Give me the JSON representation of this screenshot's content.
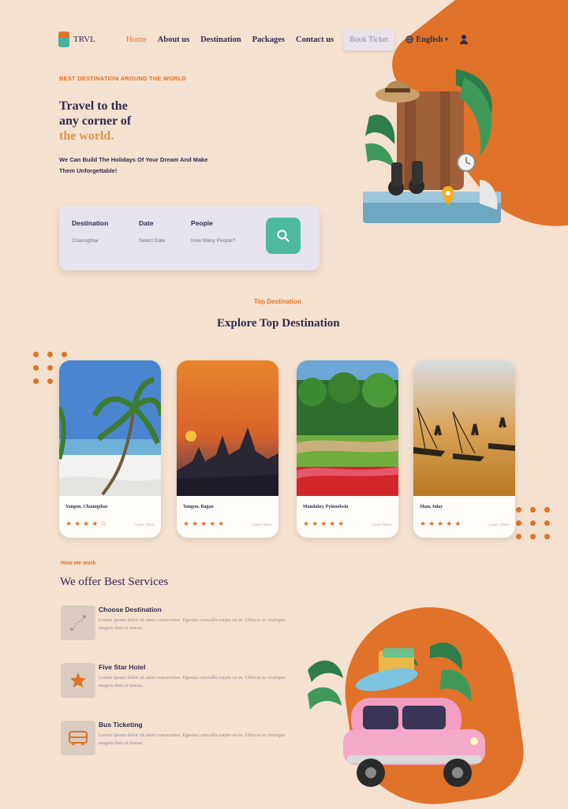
{
  "nav": {
    "logo": "TRVL",
    "links": [
      "Home",
      "About us",
      "Destination",
      "Packages",
      "Contact us"
    ],
    "book_ticket": "Book Ticket",
    "language": "English",
    "language_icon": "globe-icon",
    "user_icon": "user-icon"
  },
  "hero": {
    "eyebrow": "BEST DESTINATION AROUND THE WORLD",
    "title_line1": "Travel to the",
    "title_line2": "any corner of",
    "title_accent": "the world.",
    "subtitle": "We Can Build The Holidays Of Your Dream And Make Them Unforgettable!"
  },
  "search": {
    "destination_label": "Destination",
    "destination_placeholder": "Chaungthar",
    "date_label": "Date",
    "date_placeholder": "Select Date",
    "people_label": "People",
    "people_placeholder": "How Many People?",
    "button_icon": "search-icon"
  },
  "top_destination": {
    "eyebrow": "Top Destination",
    "title": "Explore Top Destination",
    "cards": [
      {
        "name": "Yangon, Chaungthar",
        "rating": 4,
        "link": "Learn More"
      },
      {
        "name": "Yangon, Bagan",
        "rating": 5,
        "link": "Learn More"
      },
      {
        "name": "Mandalay, Pyinoolwin",
        "rating": 5,
        "link": "Learn More"
      },
      {
        "name": "Shan, Inlay",
        "rating": 5,
        "link": "Learn More"
      }
    ]
  },
  "services": {
    "eyebrow": "How we work",
    "title": "We offer Best Services",
    "items": [
      {
        "title": "Choose Destination",
        "icon": "route-icon",
        "desc": "Lorem ipsum dolor sit amet consectetur. Egestas convallis turpis eu in. Ultrices ac tristique magnis duis et massa."
      },
      {
        "title": "Five Star Hotel",
        "icon": "star-icon",
        "desc": "Lorem ipsum dolor sit amet consectetur. Egestas convallis turpis eu in. Ultrices ac tristique magnis duis et massa."
      },
      {
        "title": "Bus Ticketing",
        "icon": "bus-icon",
        "desc": "Lorem ipsum dolor sit amet consectetur. Egestas convallis turpis eu in. Ultrices ac tristique magnis duis et massa."
      }
    ]
  },
  "colors": {
    "background": "#f5e1cf",
    "accent": "#e0722a",
    "primary_text": "#2e2b4f",
    "search_button": "#4db99e"
  }
}
